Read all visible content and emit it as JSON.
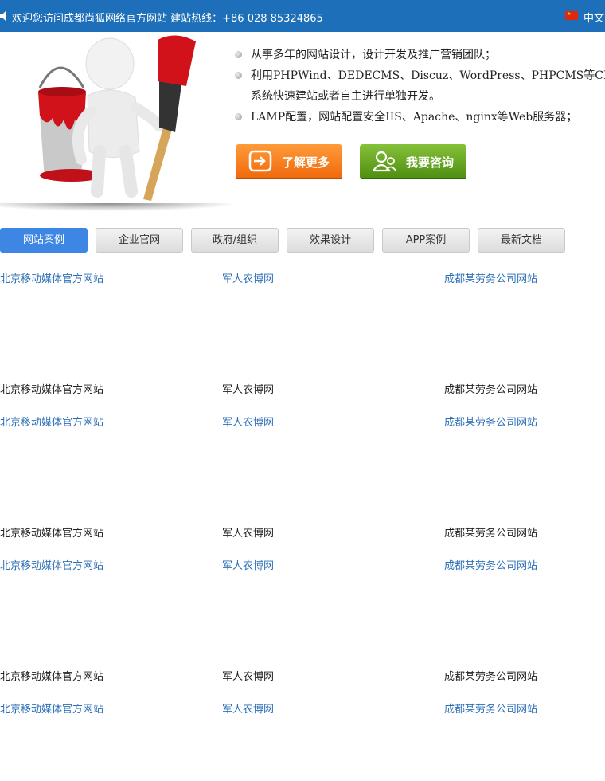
{
  "topbar": {
    "welcome": "欢迎您访问成都尚狐网络官方网站 建站热线：+86 028 85324865",
    "language": "中文",
    "speaker_icon": "speaker-icon",
    "flag_icon": "china-flag-icon"
  },
  "hero": {
    "features": [
      "从事多年的网站设计，设计开发及推广营销团队；",
      "利用PHPWind、DEDECMS、Discuz、WordPress、PHPCMS等CMS",
      "系统快速建站或者自主进行单独开发。",
      "LAMP配置，网站配置安全IIS、Apache、nginx等Web服务器；"
    ],
    "more_button": "了解更多",
    "consult_button": "我要咨询",
    "colors": {
      "orange": "#f07a1a",
      "green": "#5e9e1c"
    }
  },
  "tabs": [
    "网站案例",
    "企业官网",
    "政府/组织",
    "效果设计",
    "APP案例",
    "最新文档"
  ],
  "cases": [
    {
      "links": [
        "北京移动媒体官方网站",
        "军人农博网",
        "成都某劳务公司网站"
      ],
      "captions": [
        "北京移动媒体官方网站",
        "军人农博网",
        "成都某劳务公司网站"
      ]
    },
    {
      "links": [
        "北京移动媒体官方网站",
        "军人农博网",
        "成都某劳务公司网站"
      ],
      "captions": [
        "北京移动媒体官方网站",
        "军人农博网",
        "成都某劳务公司网站"
      ]
    },
    {
      "links": [
        "北京移动媒体官方网站",
        "军人农博网",
        "成都某劳务公司网站"
      ],
      "captions": [
        "北京移动媒体官方网站",
        "军人农博网",
        "成都某劳务公司网站"
      ]
    },
    {
      "links": [
        "北京移动媒体官方网站",
        "军人农博网",
        "成都某劳务公司网站"
      ]
    }
  ]
}
